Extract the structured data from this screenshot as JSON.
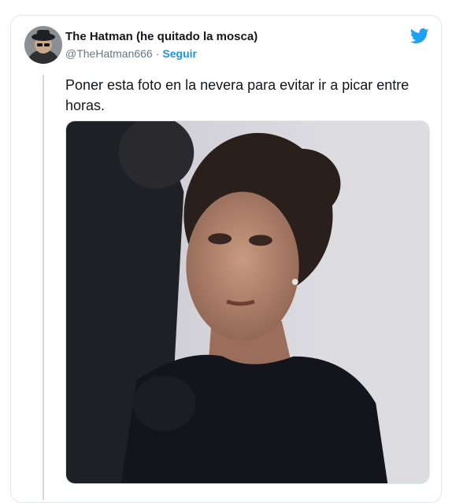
{
  "tweet": {
    "author_name": "The Hatman (he quitado la mosca)",
    "handle": "@TheHatman666",
    "separator": "·",
    "follow_label": "Seguir",
    "text": "Poner esta foto en la nevera para evitar ir a picar entre horas.",
    "platform_icon": "twitter-bird-icon",
    "accent_color": "#1b95e0"
  }
}
